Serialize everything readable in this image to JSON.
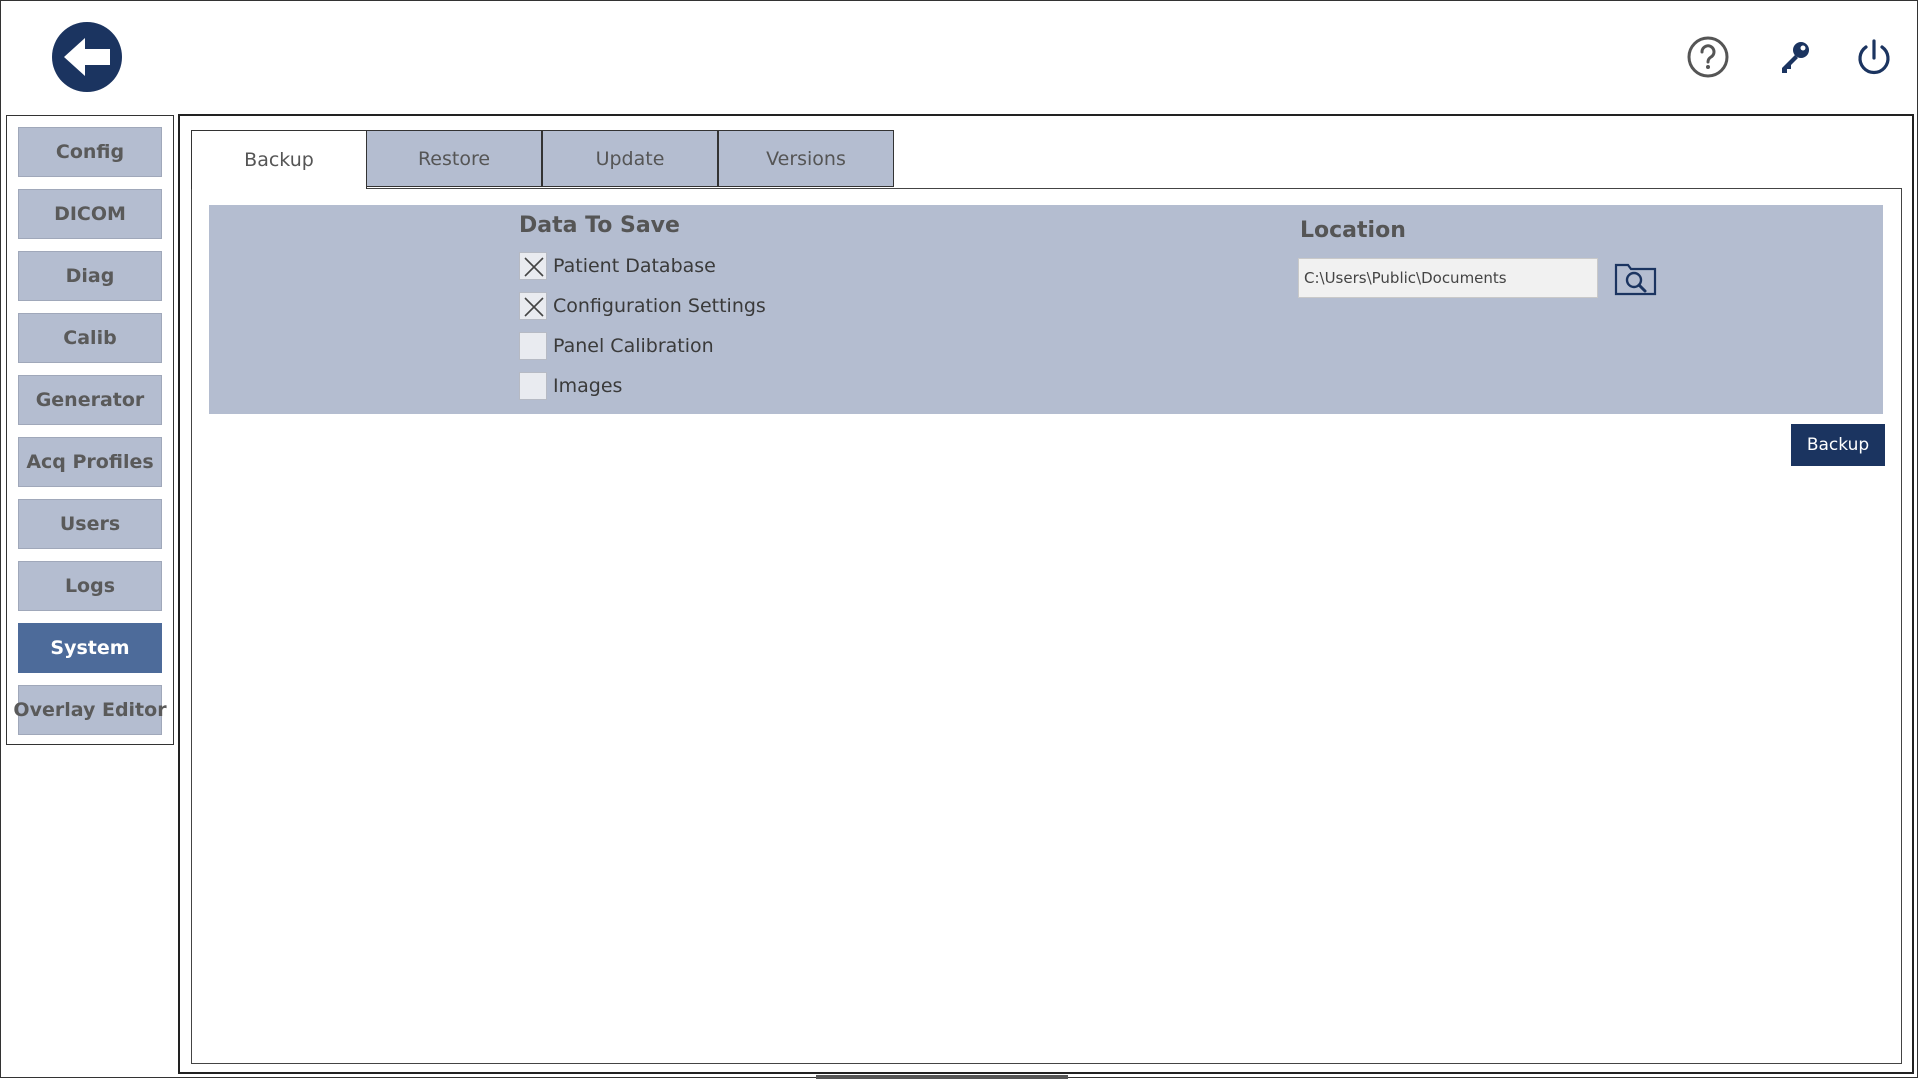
{
  "header": {
    "back_icon": "back-arrow-icon",
    "help_icon": "help-icon",
    "key_icon": "key-icon",
    "power_icon": "power-icon",
    "accent_color": "#1b3460"
  },
  "sidebar": {
    "items": [
      {
        "label": "Config"
      },
      {
        "label": "DICOM"
      },
      {
        "label": "Diag"
      },
      {
        "label": "Calib"
      },
      {
        "label": "Generator"
      },
      {
        "label": "Acq Profiles"
      },
      {
        "label": "Users"
      },
      {
        "label": "Logs"
      },
      {
        "label": "System",
        "active": true
      },
      {
        "label": "Overlay Editor"
      }
    ],
    "active_color": "#4d6b9a",
    "inactive_color": "#b4bdd0"
  },
  "tabs": [
    {
      "label": "Backup",
      "active": true
    },
    {
      "label": "Restore"
    },
    {
      "label": "Update"
    },
    {
      "label": "Versions"
    }
  ],
  "backup": {
    "data_to_save_title": "Data To Save",
    "options": [
      {
        "label": "Patient Database",
        "checked": true
      },
      {
        "label": "Configuration Settings",
        "checked": true
      },
      {
        "label": "Panel Calibration",
        "checked": false
      },
      {
        "label": "Images",
        "checked": false
      }
    ],
    "location_title": "Location",
    "location_value": "C:\\Users\\Public\\Documents",
    "browse_icon": "folder-search-icon",
    "action_label": "Backup"
  }
}
